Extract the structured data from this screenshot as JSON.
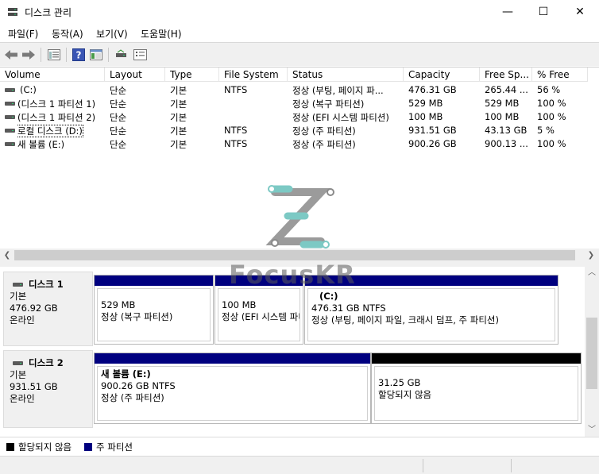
{
  "window": {
    "title": "디스크 관리",
    "controls": {
      "minimize": "—",
      "maximize": "☐",
      "close": "✕"
    }
  },
  "menu": [
    "파일(F)",
    "동작(A)",
    "보기(V)",
    "도움말(H)"
  ],
  "toolbar": {
    "icons": [
      "back-arrow-icon",
      "forward-arrow-icon",
      "properties-icon",
      "help-icon",
      "console-tree-icon",
      "connect-drive-icon",
      "options-icon"
    ]
  },
  "volume_table": {
    "headers": [
      "Volume",
      "Layout",
      "Type",
      "File System",
      "Status",
      "Capacity",
      "Free Sp...",
      "% Free"
    ],
    "rows": [
      {
        "volume": "(C:)",
        "layout": "단순",
        "type": "기본",
        "fs": "NTFS",
        "status": "정상 (부팅, 페이지 파...",
        "capacity": "476.31 GB",
        "free": "265.44 ...",
        "pct": "56 %"
      },
      {
        "volume": "(디스크 1 파티션 1)",
        "layout": "단순",
        "type": "기본",
        "fs": "",
        "status": "정상 (복구 파티션)",
        "capacity": "529 MB",
        "free": "529 MB",
        "pct": "100 %"
      },
      {
        "volume": "(디스크 1 파티션 2)",
        "layout": "단순",
        "type": "기본",
        "fs": "",
        "status": "정상 (EFI 시스템 파티션)",
        "capacity": "100 MB",
        "free": "100 MB",
        "pct": "100 %"
      },
      {
        "volume": "로컬 디스크 (D:)",
        "layout": "단순",
        "type": "기본",
        "fs": "NTFS",
        "status": "정상 (주 파티션)",
        "capacity": "931.51 GB",
        "free": "43.13 GB",
        "pct": "5 %"
      },
      {
        "volume": "새 볼륨 (E:)",
        "layout": "단순",
        "type": "기본",
        "fs": "NTFS",
        "status": "정상 (주 파티션)",
        "capacity": "900.26 GB",
        "free": "900.13 ...",
        "pct": "100 %"
      }
    ]
  },
  "disks": [
    {
      "name": "디스크 1",
      "type": "기본",
      "size": "476.92 GB",
      "state": "온라인",
      "partitions": [
        {
          "title": "",
          "line1": "529 MB",
          "line2": "정상 (복구 파티션)",
          "color": "#00007f"
        },
        {
          "title": "",
          "line1": "100 MB",
          "line2": "정상 (EFI 시스템 파티션)",
          "color": "#00007f"
        },
        {
          "title": "(C:)",
          "line1": "476.31 GB NTFS",
          "line2": "정상 (부팅, 페이지 파일, 크래시 덤프, 주 파티션)",
          "color": "#00007f"
        }
      ]
    },
    {
      "name": "디스크 2",
      "type": "기본",
      "size": "931.51 GB",
      "state": "온라인",
      "partitions": [
        {
          "title": "새 볼륨  (E:)",
          "line1": "900.26 GB NTFS",
          "line2": "정상 (주 파티션)",
          "color": "#00007f"
        },
        {
          "title": "",
          "line1": "31.25 GB",
          "line2": "할당되지 않음",
          "color": "#000000"
        }
      ]
    }
  ],
  "legend": [
    {
      "label": "할당되지 않음",
      "color": "#000000"
    },
    {
      "label": "주 파티션",
      "color": "#00007f"
    }
  ],
  "watermark": {
    "text": "FocusKR",
    "colors": {
      "teal": "#7cc9c4",
      "gray": "#8a8a8a"
    }
  }
}
